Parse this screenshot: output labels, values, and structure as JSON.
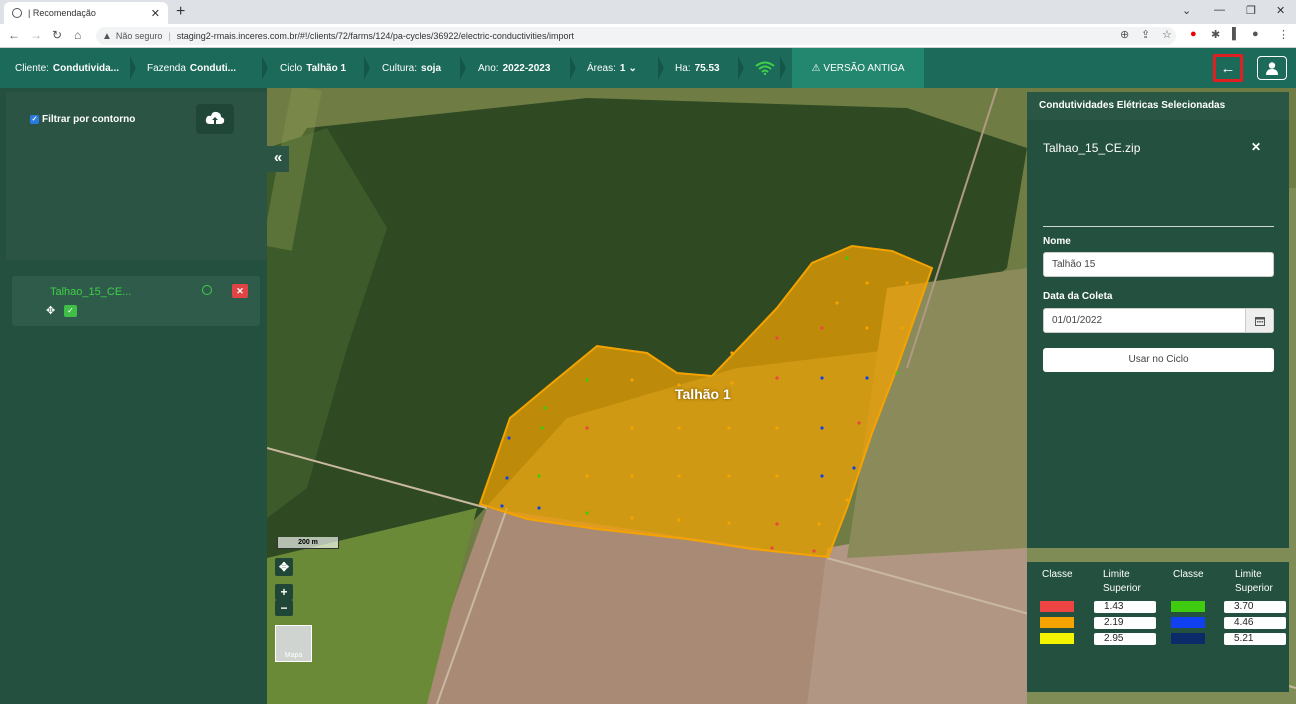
{
  "browser": {
    "tab_title": "| Recomendação",
    "not_secure": "Não seguro",
    "url": "staging2-rmais.inceres.com.br/#!/clients/72/farms/124/pa-cycles/36922/electric-conductivities/import"
  },
  "header": {
    "cliente_label": "Cliente:",
    "cliente_value": "Condutivida...",
    "fazenda_label": "Fazenda",
    "fazenda_value": "Conduti...",
    "ciclo_label": "Ciclo",
    "ciclo_value": "Talhão 1",
    "cultura_label": "Cultura:",
    "cultura_value": "soja",
    "ano_label": "Ano:",
    "ano_value": "2022-2023",
    "areas_label": "Áreas:",
    "areas_value": "1",
    "ha_label": "Ha:",
    "ha_value": "75.53",
    "old_version": "VERSÃO ANTIGA"
  },
  "left_panel": {
    "filter_label": "Filtrar por contorno",
    "file_name": "Talhao_15_CE..."
  },
  "map": {
    "field_label": "Talhão 1",
    "scale_label": "200 m",
    "basemap_label": "Mapa",
    "zoom_in": "+",
    "zoom_out": "−"
  },
  "right_panel": {
    "title": "Condutividades Elétricas Selecionadas",
    "file_name": "Talhao_15_CE.zip",
    "nome_label": "Nome",
    "nome_value": "Talhão 15",
    "data_label": "Data da Coleta",
    "data_value": "01/01/2022",
    "use_button": "Usar no Ciclo"
  },
  "legend": {
    "col_classe": "Classe",
    "col_limite": "Limite Superior",
    "classes": [
      {
        "color": "#ee4444",
        "value": "1.43"
      },
      {
        "color": "#f5a300",
        "value": "2.19"
      },
      {
        "color": "#f4f400",
        "value": "2.95"
      },
      {
        "color": "#3fcc10",
        "value": "3.70"
      },
      {
        "color": "#1040f0",
        "value": "4.46"
      },
      {
        "color": "#0a2a6a",
        "value": "5.21"
      }
    ]
  }
}
